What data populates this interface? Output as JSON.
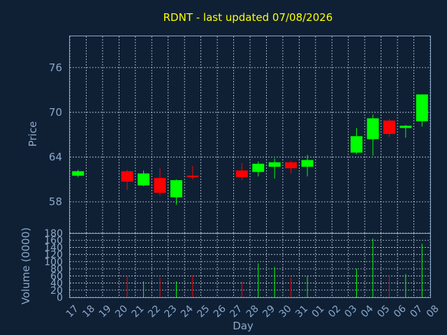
{
  "chart_data": {
    "type": "candlestick",
    "title": "RDNT - last updated 07/08/2026",
    "xlabel": "Day",
    "price_ylabel": "Price",
    "volume_ylabel": "Volume (0000)",
    "x_ticks": [
      "17",
      "18",
      "19",
      "20",
      "21",
      "22",
      "23",
      "24",
      "25",
      "26",
      "27",
      "28",
      "29",
      "30",
      "31",
      "01",
      "02",
      "03",
      "04",
      "05",
      "06",
      "07",
      "08"
    ],
    "price_ylim": [
      53.8,
      80.2
    ],
    "price_ticks": [
      58,
      64,
      70,
      76
    ],
    "volume_ylim": [
      0,
      180
    ],
    "volume_ticks": [
      0,
      20,
      40,
      60,
      80,
      100,
      120,
      140,
      160,
      180
    ],
    "up_color": "#00ff00",
    "down_color": "#ff0000",
    "candles": [
      {
        "day": 0,
        "open": 61.5,
        "close": 62.1,
        "high": 62.3,
        "low": 61.3,
        "volume": 0
      },
      {
        "day": 3,
        "open": 62.1,
        "close": 60.7,
        "high": 62.3,
        "low": 59.6,
        "volume": 60
      },
      {
        "day": 4,
        "open": 60.2,
        "close": 61.8,
        "high": 62.2,
        "low": 60.1,
        "volume": 45
      },
      {
        "day": 5,
        "open": 61.2,
        "close": 59.2,
        "high": 62.5,
        "low": 58.8,
        "volume": 55
      },
      {
        "day": 6,
        "open": 58.6,
        "close": 60.9,
        "high": 61.0,
        "low": 57.6,
        "volume": 45
      },
      {
        "day": 7,
        "open": 61.5,
        "close": 61.4,
        "high": 62.8,
        "low": 61.0,
        "volume": 62
      },
      {
        "day": 10,
        "open": 62.2,
        "close": 61.3,
        "high": 63.2,
        "low": 60.9,
        "volume": 45
      },
      {
        "day": 11,
        "open": 62.0,
        "close": 63.1,
        "high": 63.4,
        "low": 61.4,
        "volume": 95
      },
      {
        "day": 12,
        "open": 62.7,
        "close": 63.3,
        "high": 63.8,
        "low": 61.1,
        "volume": 85
      },
      {
        "day": 13,
        "open": 63.3,
        "close": 62.5,
        "high": 63.5,
        "low": 61.8,
        "volume": 55
      },
      {
        "day": 14,
        "open": 62.7,
        "close": 63.6,
        "high": 64.3,
        "low": 61.4,
        "volume": 60
      },
      {
        "day": 17,
        "open": 64.6,
        "close": 66.8,
        "high": 67.9,
        "low": 64.4,
        "volume": 80
      },
      {
        "day": 18,
        "open": 66.4,
        "close": 69.2,
        "high": 69.7,
        "low": 64.2,
        "volume": 165
      },
      {
        "day": 19,
        "open": 68.9,
        "close": 67.1,
        "high": 69.1,
        "low": 66.7,
        "volume": 62
      },
      {
        "day": 20,
        "open": 67.9,
        "close": 68.2,
        "high": 68.3,
        "low": 66.6,
        "volume": 65
      },
      {
        "day": 21,
        "open": 68.8,
        "close": 72.4,
        "high": 72.4,
        "low": 68.1,
        "volume": 150
      }
    ]
  }
}
